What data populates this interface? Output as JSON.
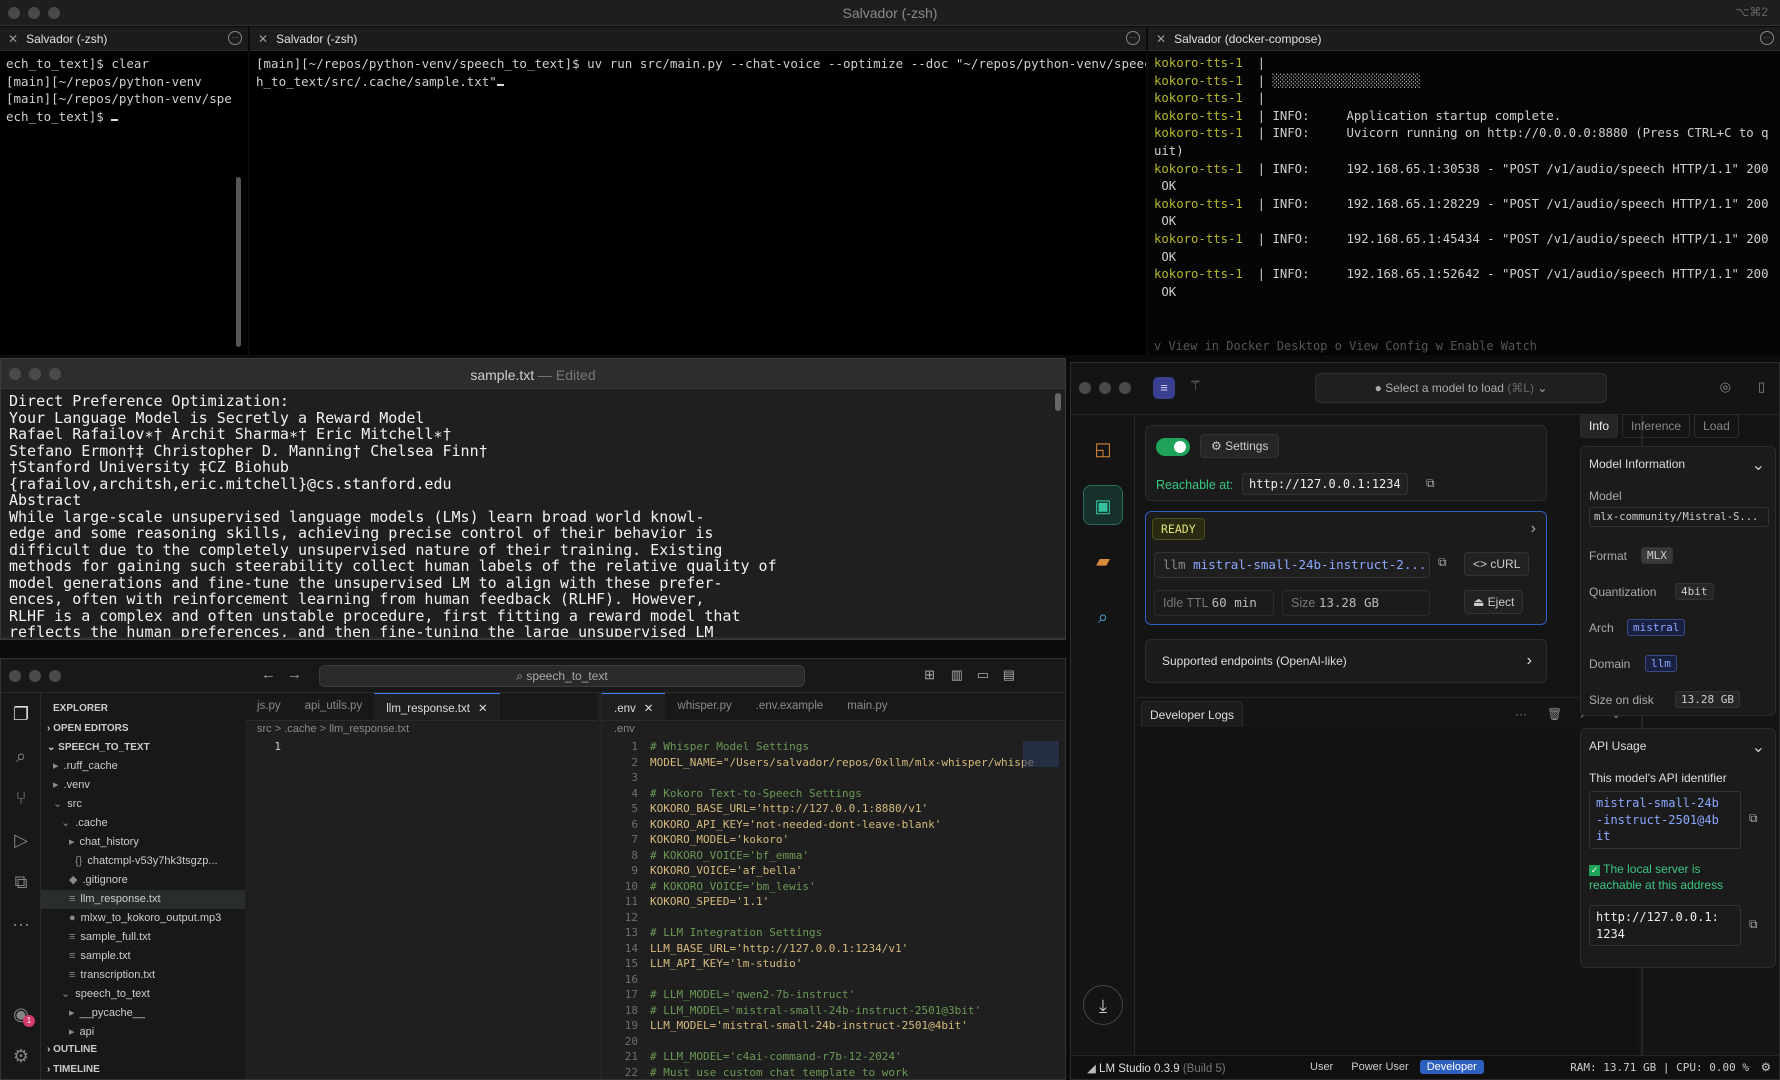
{
  "window_title": "Salvador (-zsh)",
  "window_kbd": "⌥⌘2",
  "term1": {
    "title": "Salvador (-zsh)",
    "lines": [
      "ech_to_text]$ clear",
      "[main][~/repos/python-venv",
      "[main][~/repos/python-venv/spe",
      "ech_to_text]$ "
    ]
  },
  "term2": {
    "title": "Salvador (-zsh)",
    "lines": [
      "[main][~/repos/python-venv/speech_to_text]$ uv run src/main.py --chat-voice --optimize --doc \"~/repos/python-venv/speec",
      "h_to_text/src/.cache/sample.txt\""
    ]
  },
  "term3": {
    "title": "Salvador (docker-compose)",
    "prefix": "kokoro-tts-1",
    "lines": [
      "|",
      "| ░░░░░░░░░░░░░░░░░░░░",
      "|",
      "| INFO:     Application startup complete.",
      "| INFO:     Uvicorn running on http://0.0.0.0:8880 (Press CTRL+C to q",
      "uit)",
      "| INFO:     192.168.65.1:30538 - \"POST /v1/audio/speech HTTP/1.1\" 200",
      " OK",
      "| INFO:     192.168.65.1:28229 - \"POST /v1/audio/speech HTTP/1.1\" 200",
      " OK",
      "| INFO:     192.168.65.1:45434 - \"POST /v1/audio/speech HTTP/1.1\" 200",
      " OK",
      "| INFO:     192.168.65.1:52642 - \"POST /v1/audio/speech HTTP/1.1\" 200",
      " OK"
    ],
    "footer": "v View in Docker Desktop   o View Config   w Enable Watch"
  },
  "textedit": {
    "filename": "sample.txt",
    "status": "— Edited",
    "lines": [
      "Direct Preference Optimization:",
      "Your Language Model is Secretly a Reward Model",
      "Rafael Rafailov∗† Archit Sharma∗† Eric Mitchell∗†",
      "Stefano Ermon†‡ Christopher D. Manning† Chelsea Finn†",
      "†Stanford University ‡CZ Biohub",
      "{rafailov,architsh,eric.mitchell}@cs.stanford.edu",
      "Abstract",
      "While large-scale unsupervised language models (LMs) learn broad world knowl-",
      "edge and some reasoning skills, achieving precise control of their behavior is",
      "difficult due to the completely unsupervised nature of their training. Existing",
      "methods for gaining such steerability collect human labels of the relative quality of",
      "model generations and fine-tune the unsupervised LM to align with these prefer-",
      "ences, often with reinforcement learning from human feedback (RLHF). However,",
      "RLHF is a complex and often unstable procedure, first fitting a reward model that",
      "reflects the human preferences, and then fine-tuning the large unsupervised LM"
    ]
  },
  "vscode": {
    "search": "speech_to_text",
    "explorer": {
      "title": "EXPLORER",
      "open_editors": "OPEN EDITORS",
      "project": "SPEECH_TO_TEXT",
      "items": [
        ".ruff_cache",
        ".venv",
        "src",
        ".cache",
        "chat_history",
        "chatcmpl-v53y7hk3tsgzp...",
        ".gitignore",
        "llm_response.txt",
        "mlxw_to_kokoro_output.mp3",
        "sample_full.txt",
        "sample.txt",
        "transcription.txt",
        "speech_to_text",
        "__pycache__",
        "api"
      ],
      "outline": "OUTLINE",
      "timeline": "TIMELINE"
    },
    "tabs_left": [
      "js.py",
      "api_utils.py",
      "llm_response.txt"
    ],
    "crumb_left": "src  >  .cache  >  llm_response.txt",
    "tabs_right": [
      ".env",
      "whisper.py",
      ".env.example",
      "main.py"
    ],
    "crumb_right": ".env",
    "code": [
      {
        "n": "1",
        "t": "# Whisper Model Settings",
        "c": "cm"
      },
      {
        "n": "2",
        "t": "MODEL_NAME=\"/Users/salvador/repos/0xllm/mlx-whisper/whispe",
        "c": "vs"
      },
      {
        "n": "3",
        "t": "",
        "c": ""
      },
      {
        "n": "4",
        "t": "# Kokoro Text-to-Speech Settings",
        "c": "cm"
      },
      {
        "n": "5",
        "t": "KOKORO_BASE_URL='http://127.0.0.1:8880/v1'",
        "c": "vs"
      },
      {
        "n": "6",
        "t": "KOKORO_API_KEY='not-needed-dont-leave-blank'",
        "c": "vs"
      },
      {
        "n": "7",
        "t": "KOKORO_MODEL='kokoro'",
        "c": "vs"
      },
      {
        "n": "8",
        "t": "# KOKORO_VOICE='bf_emma'",
        "c": "cm"
      },
      {
        "n": "9",
        "t": "KOKORO_VOICE='af_bella'",
        "c": "vs"
      },
      {
        "n": "10",
        "t": "# KOKORO_VOICE='bm_lewis'",
        "c": "cm"
      },
      {
        "n": "11",
        "t": "KOKORO_SPEED='1.1'",
        "c": "vs"
      },
      {
        "n": "12",
        "t": "",
        "c": ""
      },
      {
        "n": "13",
        "t": "# LLM Integration Settings",
        "c": "cm"
      },
      {
        "n": "14",
        "t": "LLM_BASE_URL='http://127.0.0.1:1234/v1'",
        "c": "vs"
      },
      {
        "n": "15",
        "t": "LLM_API_KEY='lm-studio'",
        "c": "vs"
      },
      {
        "n": "16",
        "t": "",
        "c": ""
      },
      {
        "n": "17",
        "t": "# LLM_MODEL='qwen2-7b-instruct'",
        "c": "cm"
      },
      {
        "n": "18",
        "t": "# LLM_MODEL='mistral-small-24b-instruct-2501@3bit'",
        "c": "cm"
      },
      {
        "n": "19",
        "t": "LLM_MODEL='mistral-small-24b-instruct-2501@4bit'",
        "c": "vs"
      },
      {
        "n": "20",
        "t": "",
        "c": ""
      },
      {
        "n": "21",
        "t": "# LLM_MODEL='c4ai-command-r7b-12-2024'",
        "c": "cm"
      },
      {
        "n": "22",
        "t": "# Must use custom chat template to work",
        "c": "cm"
      }
    ],
    "badge": "1"
  },
  "lmstudio": {
    "select_model": "Select a model to load",
    "select_kbd": "(⌘L)",
    "settings": "Settings",
    "reachable_label": "Reachable at:",
    "reachable_url": "http://127.0.0.1:1234",
    "ready": "READY",
    "model_tag": "llm",
    "model_name": "mistral-small-24b-instruct-2...",
    "curl": "cURL",
    "idle_label": "Idle TTL",
    "idle_value": "60 min",
    "size_label": "Size",
    "size_value": "13.28 GB",
    "eject": "Eject",
    "endpoints": "Supported endpoints (OpenAI-like)",
    "dev_logs": "Developer Logs",
    "tabs": [
      "Info",
      "Inference",
      "Load"
    ],
    "info": {
      "section": "Model Information",
      "model_label": "Model",
      "model_value": "mlx-community/Mistral-S...",
      "format_label": "Format",
      "format_value": "MLX",
      "quant_label": "Quantization",
      "quant_value": "4bit",
      "arch_label": "Arch",
      "arch_value": "mistral",
      "domain_label": "Domain",
      "domain_value": "llm",
      "size_label": "Size on disk",
      "size_value": "13.28 GB"
    },
    "api": {
      "section": "API Usage",
      "identifier_label": "This model's API identifier",
      "identifier_lines": [
        "mistral-small-24b",
        "-instruct-2501@4b",
        "it"
      ],
      "reachable_note_1": "The local server is",
      "reachable_note_2": "reachable at this address",
      "url_lines": [
        "http://127.0.0.1:",
        "1234"
      ]
    },
    "status": {
      "version": "LM Studio 0.3.9",
      "build": "(Build 5)",
      "modes": [
        "User",
        "Power User",
        "Developer"
      ],
      "ram": "RAM: 13.71 GB | CPU: 0.00 %"
    }
  }
}
